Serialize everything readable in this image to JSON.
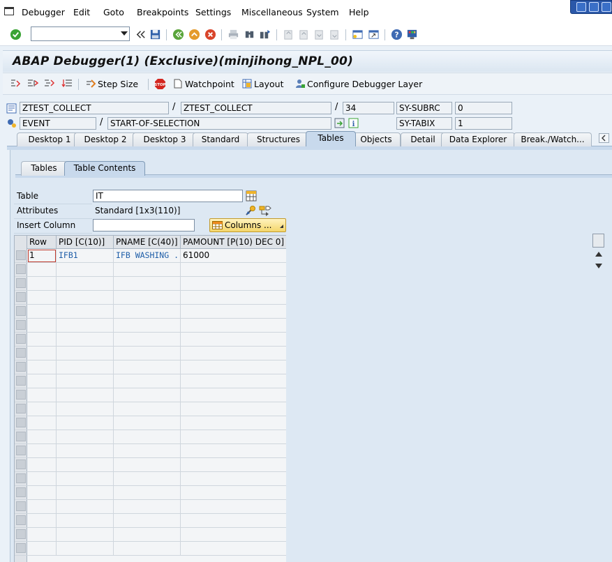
{
  "menubar": {
    "items": [
      "Debugger",
      "Edit",
      "Goto",
      "Breakpoints",
      "Settings",
      "Miscellaneous",
      "System",
      "Help"
    ]
  },
  "toolbar": {
    "command_field_value": "",
    "icons": [
      "enter-icon",
      "back-icon",
      "save-icon",
      "back-green-icon",
      "exit-icon",
      "cancel-icon",
      "print-icon",
      "find-icon",
      "find-next-icon",
      "first-page-icon",
      "prev-page-icon",
      "next-page-icon",
      "last-page-icon",
      "new-session-icon",
      "shortcut-icon",
      "help-icon",
      "layout-icon"
    ]
  },
  "title": "ABAP Debugger(1)  (Exclusive)(minjihong_NPL_00)",
  "app_toolbar": {
    "step_size": "Step Size",
    "watchpoint": "Watchpoint",
    "layout": "Layout",
    "configure": "Configure Debugger Layer"
  },
  "info": {
    "program": "ZTEST_COLLECT",
    "include": "ZTEST_COLLECT",
    "line": "34",
    "event_type": "EVENT",
    "event_name": "START-OF-SELECTION",
    "sy_subrc_label": "SY-SUBRC",
    "sy_subrc_value": "0",
    "sy_tabix_label": "SY-TABIX",
    "sy_tabix_value": "1",
    "slash": "/"
  },
  "tabs": [
    "Desktop 1",
    "Desktop 2",
    "Desktop 3",
    "Standard",
    "Structures",
    "Tables",
    "Objects",
    "Detail",
    "Data Explorer",
    "Break./Watch..."
  ],
  "active_tab": "Tables",
  "subtabs": [
    "Tables",
    "Table Contents"
  ],
  "active_subtab": "Table Contents",
  "form": {
    "table_label": "Table",
    "table_value": "IT",
    "attributes_label": "Attributes",
    "attributes_value": "Standard [1x3(110)]",
    "insert_column_label": "Insert Column",
    "insert_column_value": "",
    "columns_button": "Columns ..."
  },
  "grid": {
    "headers": [
      "Row",
      "PID [C(10)]",
      "PNAME [C(40)]",
      "PAMOUNT [P(10) DEC 0]"
    ],
    "rows": [
      [
        "1",
        "IFB1",
        "IFB WASHING ...",
        "61000"
      ]
    ]
  }
}
